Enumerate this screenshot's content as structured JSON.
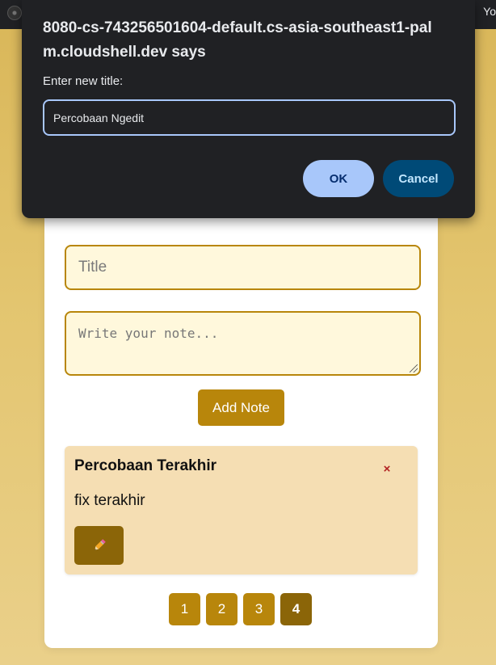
{
  "browser": {
    "right_text": "Yo"
  },
  "dialog": {
    "origin": "8080-cs-743256501604-default.cs-asia-southeast1-palm.cloudshell.dev says",
    "message": "Enter new title:",
    "input_value": "Percobaan Ngedit",
    "ok_label": "OK",
    "cancel_label": "Cancel"
  },
  "form": {
    "title_placeholder": "Title",
    "note_placeholder": "Write your note...",
    "add_label": "Add Note"
  },
  "note": {
    "title": "Percobaan Terakhir",
    "body": "fix terakhir",
    "delete_glyph": "×",
    "edit_glyph": "✏️",
    "edit_icon": "pencil-icon"
  },
  "pagination": {
    "pages": [
      "1",
      "2",
      "3",
      "4"
    ],
    "current": "4"
  },
  "colors": {
    "accent": "#b8860b",
    "accent_dark": "#8b6508",
    "input_bg": "#fff8dc",
    "note_bg": "#f5deb3",
    "dialog_bg": "#202124",
    "ok_bg": "#a8c7fa",
    "cancel_bg": "#004a77"
  }
}
